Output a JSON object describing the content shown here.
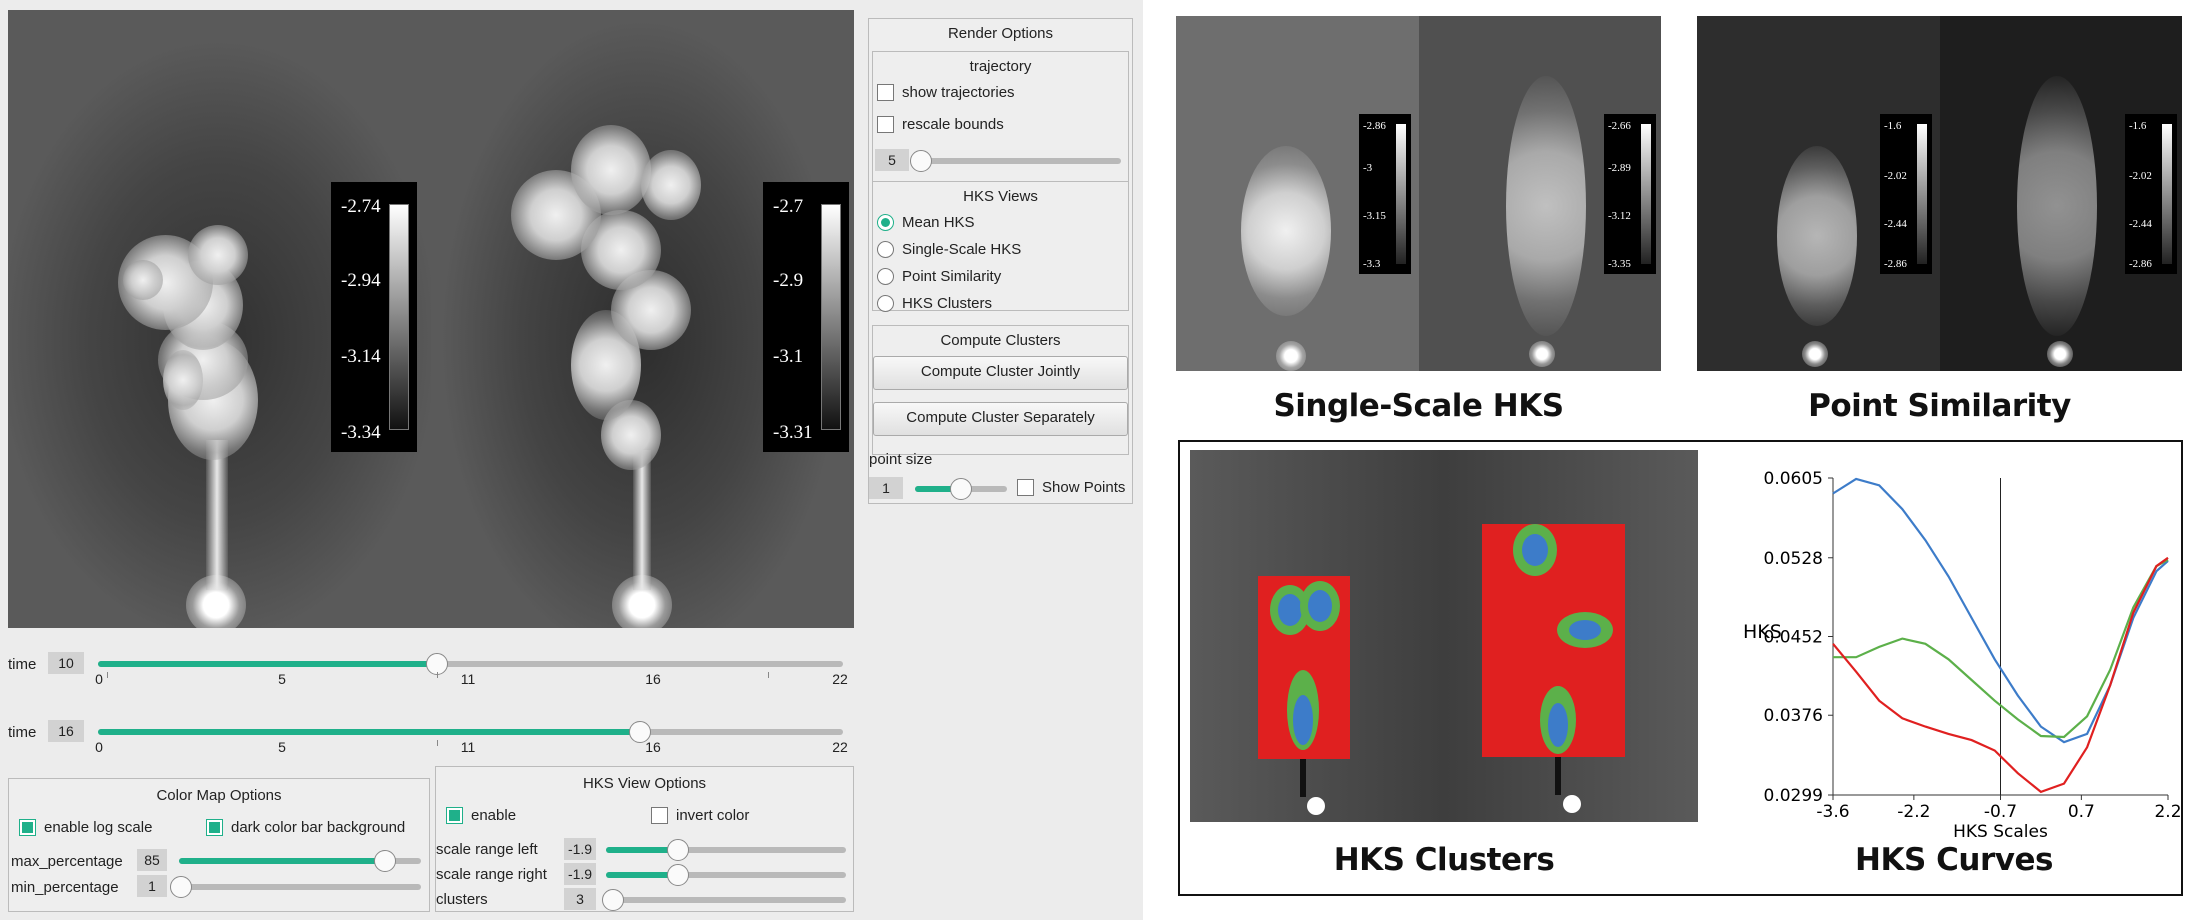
{
  "viz": {
    "left_colorbar": [
      "-2.74",
      "-2.94",
      "-3.14",
      "-3.34"
    ],
    "right_colorbar": [
      "-2.7",
      "-2.9",
      "-3.1",
      "-3.31"
    ]
  },
  "time_sliders": [
    {
      "label": "time",
      "value": "10",
      "fraction": 0.4545,
      "ticks": [
        "0",
        "5",
        "11",
        "16",
        "22"
      ]
    },
    {
      "label": "time",
      "value": "16",
      "fraction": 0.7273,
      "ticks": [
        "0",
        "5",
        "11",
        "16",
        "22"
      ]
    }
  ],
  "color_map": {
    "title": "Color Map Options",
    "log_scale": "enable log scale",
    "dark_bg": "dark color bar background",
    "max_label": "max_percentage",
    "max_value": "85",
    "max_fraction": 0.85,
    "min_label": "min_percentage",
    "min_value": "1",
    "min_fraction": 0.01
  },
  "hks_view": {
    "title": "HKS View Options",
    "enable": "enable",
    "invert": "invert color",
    "rows": [
      {
        "label": "scale range left",
        "value": "-1.9",
        "fraction": 0.3
      },
      {
        "label": "scale range right",
        "value": "-1.9",
        "fraction": 0.3
      },
      {
        "label": "clusters",
        "value": "3",
        "fraction": 0.03
      }
    ]
  },
  "render": {
    "title": "Render Options",
    "trajectory_title": "trajectory",
    "show_traj": "show trajectories",
    "rescale": "rescale bounds",
    "traj_value": "5",
    "traj_fraction": 0.0,
    "hks_title": "HKS Views",
    "hks_options": [
      "Mean HKS",
      "Single-Scale HKS",
      "Point Similarity",
      "HKS Clusters"
    ],
    "clusters_title": "Compute Clusters",
    "btn_jointly": "Compute Cluster Jointly",
    "btn_separately": "Compute Cluster Separately",
    "point_size_label": "point size",
    "point_size_value": "1",
    "point_size_fraction": 0.5,
    "show_points": "Show Points"
  },
  "panels": {
    "single_scale": {
      "caption": "Single-Scale HKS",
      "bar_left": [
        "-2.86",
        "-3",
        "-3.15",
        "-3.3"
      ],
      "bar_right": [
        "-2.66",
        "-2.89",
        "-3.12",
        "-3.35"
      ]
    },
    "point_similarity": {
      "caption": "Point Similarity",
      "bar_left": [
        "-1.6",
        "-2.02",
        "-2.44",
        "-2.86"
      ],
      "bar_right": [
        "-1.6",
        "-2.02",
        "-2.44",
        "-2.86"
      ]
    },
    "hks_clusters": {
      "caption": "HKS Clusters"
    },
    "hks_curves": {
      "caption": "HKS Curves"
    }
  },
  "colors": {
    "accent": "#1fb08a",
    "cluster_red": "#e02020",
    "cluster_green": "#5cb04a",
    "cluster_blue": "#3d7cc9"
  },
  "chart_data": {
    "type": "line",
    "xlabel": "HKS Scales",
    "ylabel": "HKS",
    "xticks": [
      "-3.6",
      "-2.2",
      "-0.7",
      "0.7",
      "2.2"
    ],
    "yticks": [
      "0.0605",
      "0.0528",
      "0.0452",
      "0.0376",
      "0.0299"
    ],
    "xlim": [
      -3.6,
      2.2
    ],
    "ylim": [
      0.0299,
      0.0605
    ],
    "marker_x": -0.7,
    "series": [
      {
        "color": "#3d7cc9",
        "x": [
          -3.6,
          -3.2,
          -2.8,
          -2.4,
          -2.0,
          -1.6,
          -1.2,
          -0.8,
          -0.4,
          0.0,
          0.4,
          0.8,
          1.2,
          1.6,
          2.0,
          2.2
        ],
        "y": [
          0.059,
          0.0604,
          0.0598,
          0.0575,
          0.0545,
          0.051,
          0.047,
          0.043,
          0.0395,
          0.0365,
          0.035,
          0.0358,
          0.0405,
          0.047,
          0.0515,
          0.0525
        ]
      },
      {
        "color": "#5cb04a",
        "x": [
          -3.6,
          -3.2,
          -2.8,
          -2.4,
          -2.0,
          -1.6,
          -1.2,
          -0.8,
          -0.4,
          0.0,
          0.4,
          0.8,
          1.2,
          1.6,
          2.0,
          2.2
        ],
        "y": [
          0.0432,
          0.0432,
          0.0442,
          0.045,
          0.0445,
          0.043,
          0.041,
          0.039,
          0.0372,
          0.0356,
          0.0355,
          0.0375,
          0.042,
          0.048,
          0.052,
          0.0526
        ]
      },
      {
        "color": "#e02020",
        "x": [
          -3.6,
          -3.2,
          -2.8,
          -2.4,
          -2.0,
          -1.6,
          -1.2,
          -0.8,
          -0.4,
          0.0,
          0.4,
          0.8,
          1.2,
          1.6,
          2.0,
          2.2
        ],
        "y": [
          0.0445,
          0.0418,
          0.039,
          0.0373,
          0.0365,
          0.0358,
          0.0352,
          0.0342,
          0.032,
          0.0302,
          0.031,
          0.0345,
          0.0405,
          0.0475,
          0.052,
          0.0528
        ]
      }
    ]
  }
}
